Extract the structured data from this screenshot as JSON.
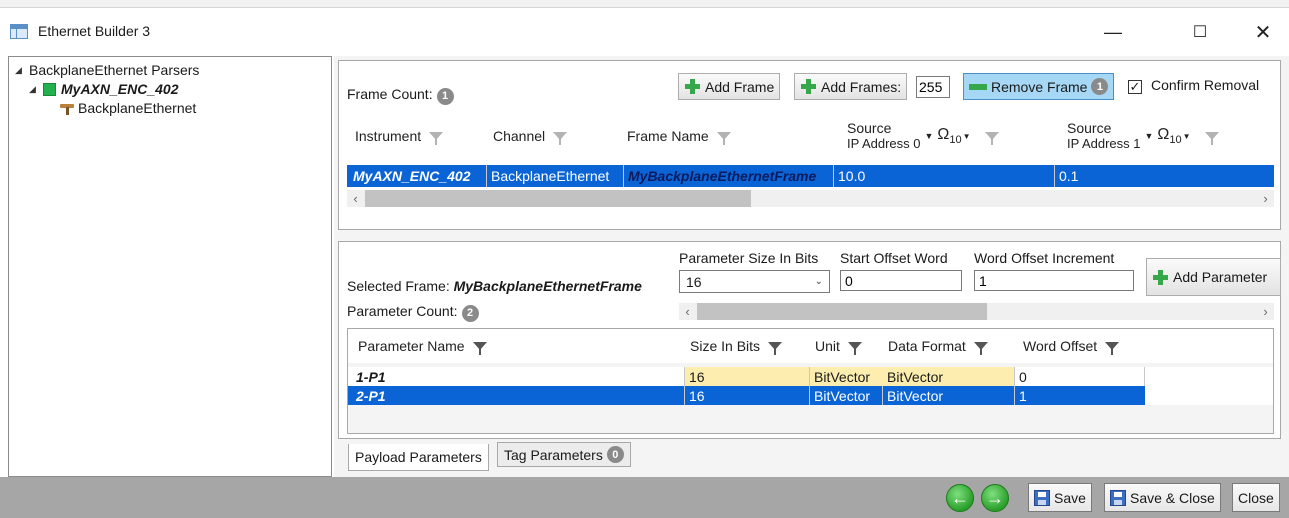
{
  "window": {
    "title": "Ethernet Builder 3"
  },
  "tree": {
    "root": "BackplaneEthernet Parsers",
    "instrument": "MyAXN_ENC_402",
    "channel": "BackplaneEthernet"
  },
  "frames": {
    "count_label": "Frame Count:",
    "count": "1",
    "add_frame": "Add Frame",
    "add_frames": "Add Frames:",
    "add_frames_value": "255",
    "remove_frame": "Remove Frame",
    "remove_badge": "1",
    "confirm_removal": "Confirm Removal",
    "confirm_checked": "✓",
    "columns": [
      "Instrument",
      "Channel",
      "Frame Name",
      "Source",
      "IP Address 0",
      "Ω",
      "10",
      "Source",
      "IP Address 1",
      "Ω",
      "10"
    ],
    "row": {
      "instrument": "MyAXN_ENC_402",
      "channel": "BackplaneEthernet",
      "frame_name": "MyBackplaneEthernetFrame",
      "ip0": "10.0",
      "ip1": "0.1"
    }
  },
  "params": {
    "selected_label": "Selected Frame:",
    "selected_frame": "MyBackplaneEthernetFrame",
    "count_label": "Parameter Count:",
    "count": "2",
    "size_label": "Parameter Size In Bits",
    "size_value": "16",
    "start_label": "Start Offset Word",
    "start_value": "0",
    "incr_label": "Word Offset Increment",
    "incr_value": "1",
    "add_parameter": "Add Parameter",
    "columns": [
      "Parameter Name",
      "Size In Bits",
      "Unit",
      "Data Format",
      "Word Offset"
    ],
    "rows": [
      {
        "name": "1-P1",
        "size": "16",
        "unit": "BitVector",
        "format": "BitVector",
        "offset": "0"
      },
      {
        "name": "2-P1",
        "size": "16",
        "unit": "BitVector",
        "format": "BitVector",
        "offset": "1"
      }
    ]
  },
  "tabs": {
    "payload": "Payload Parameters",
    "tag": "Tag Parameters",
    "tag_count": "0"
  },
  "footer": {
    "save": "Save",
    "save_close": "Save & Close",
    "close": "Close"
  },
  "colors": {
    "selection": "#0a64d6",
    "highlight": "#fdeeb0",
    "accent_green": "#37a84a"
  }
}
